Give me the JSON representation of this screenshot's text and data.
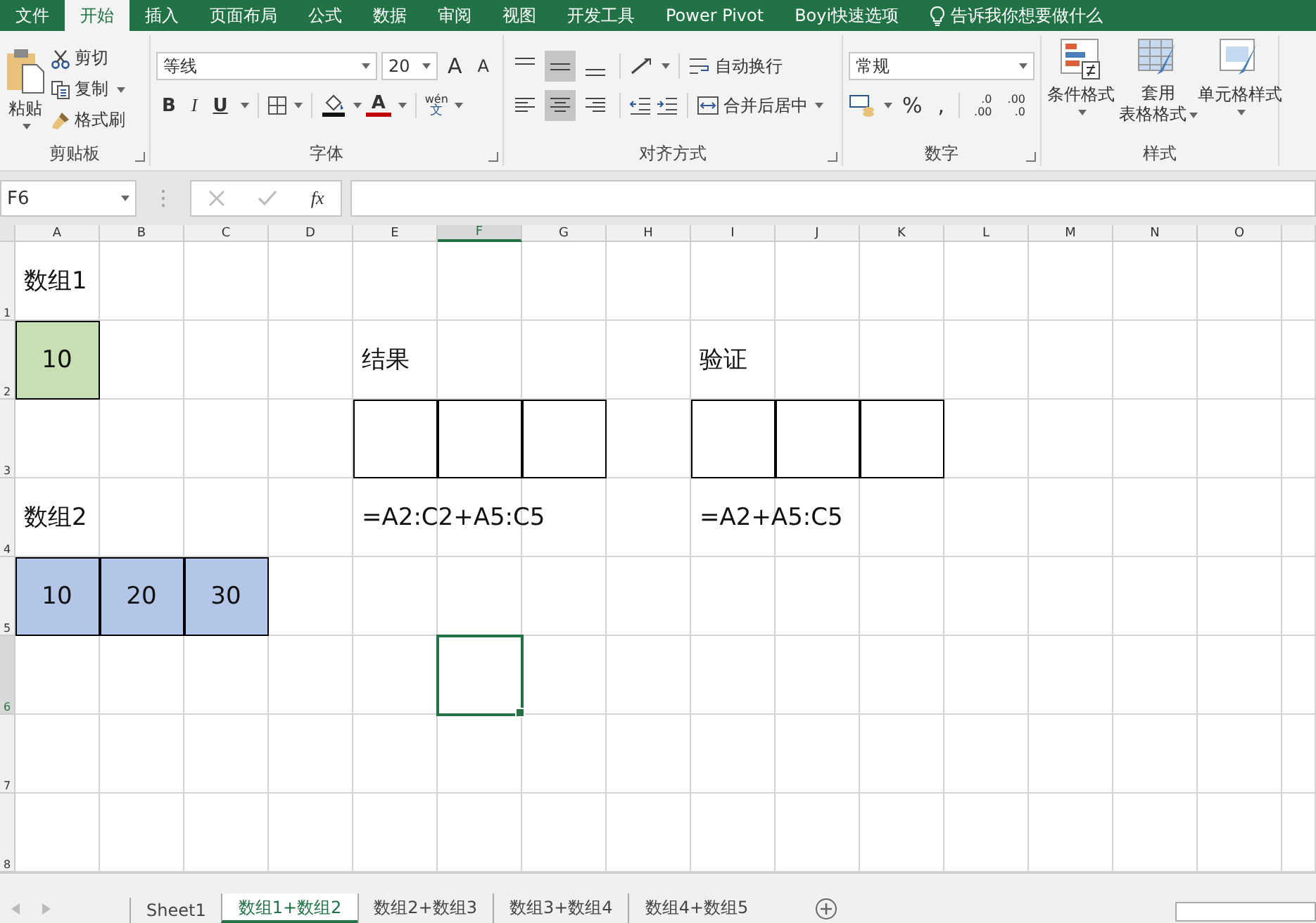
{
  "menu_tabs": [
    {
      "label": "文件",
      "selected": false
    },
    {
      "label": "开始",
      "selected": true
    },
    {
      "label": "插入",
      "selected": false
    },
    {
      "label": "页面布局",
      "selected": false
    },
    {
      "label": "公式",
      "selected": false
    },
    {
      "label": "数据",
      "selected": false
    },
    {
      "label": "审阅",
      "selected": false
    },
    {
      "label": "视图",
      "selected": false
    },
    {
      "label": "开发工具",
      "selected": false
    },
    {
      "label": "Power Pivot",
      "selected": false
    },
    {
      "label": "Boyi快速选项",
      "selected": false
    }
  ],
  "tell_me": "告诉我你想要做什么",
  "ribbon": {
    "clipboard": {
      "paste": "粘贴",
      "cut": "剪切",
      "copy": "复制",
      "format_painter": "格式刷",
      "label": "剪贴板"
    },
    "font": {
      "font_name": "等线",
      "font_size": "20",
      "grow": "A",
      "shrink": "A",
      "bold": "B",
      "italic": "I",
      "underline": "U",
      "font_color": "A",
      "phonetic_top": "wén",
      "phonetic_bottom": "文",
      "label": "字体"
    },
    "alignment": {
      "vertical": [
        {
          "selected": false
        },
        {
          "selected": true
        },
        {
          "selected": false
        }
      ],
      "horizontal": [
        {
          "selected": false
        },
        {
          "selected": true
        },
        {
          "selected": false
        }
      ],
      "wrap_text": "自动换行",
      "merge_center": "合并后居中",
      "label": "对齐方式"
    },
    "number": {
      "format": "常规",
      "percent": "%",
      "comma": ",",
      "increase_decimal": [
        ".0",
        ".00"
      ],
      "decrease_decimal": [
        ".00",
        ".0"
      ],
      "label": "数字"
    },
    "styles": {
      "conditional": "条件格式",
      "format_table": [
        "套用",
        "表格格式"
      ],
      "cell_styles": "单元格样式",
      "label": "样式"
    }
  },
  "formula_bar": {
    "name_box": "F6",
    "fx": "fx"
  },
  "sheet": {
    "columns": [
      {
        "label": "A",
        "selected": false
      },
      {
        "label": "B",
        "selected": false
      },
      {
        "label": "C",
        "selected": false
      },
      {
        "label": "D",
        "selected": false
      },
      {
        "label": "E",
        "selected": false
      },
      {
        "label": "F",
        "selected": true
      },
      {
        "label": "G",
        "selected": false
      },
      {
        "label": "H",
        "selected": false
      },
      {
        "label": "I",
        "selected": false
      },
      {
        "label": "J",
        "selected": false
      },
      {
        "label": "K",
        "selected": false
      },
      {
        "label": "L",
        "selected": false
      },
      {
        "label": "M",
        "selected": false
      },
      {
        "label": "N",
        "selected": false
      },
      {
        "label": "O",
        "selected": false
      }
    ],
    "rows": [
      {
        "label": "1",
        "selected": false,
        "cells": [
          {
            "text": "数组1",
            "kind": "text",
            "bordered": false,
            "selected": false
          },
          {
            "bordered": false,
            "selected": false
          },
          {
            "bordered": false,
            "selected": false
          },
          {
            "bordered": false,
            "selected": false
          },
          {
            "bordered": false,
            "selected": false
          },
          {
            "bordered": false,
            "selected": false
          },
          {
            "bordered": false,
            "selected": false
          },
          {
            "bordered": false,
            "selected": false
          },
          {
            "bordered": false,
            "selected": false
          },
          {
            "bordered": false,
            "selected": false
          },
          {
            "bordered": false,
            "selected": false
          },
          {
            "bordered": false,
            "selected": false
          },
          {
            "bordered": false,
            "selected": false
          },
          {
            "bordered": false,
            "selected": false
          },
          {
            "bordered": false,
            "selected": false
          }
        ]
      },
      {
        "label": "2",
        "selected": false,
        "cells": [
          {
            "text": "10",
            "kind": "number",
            "color": "#c6e0b4",
            "bordered": true,
            "selected": false
          },
          {
            "bordered": false,
            "selected": false
          },
          {
            "bordered": false,
            "selected": false
          },
          {
            "bordered": false,
            "selected": false
          },
          {
            "text": "结果",
            "kind": "text",
            "bordered": false,
            "selected": false
          },
          {
            "bordered": false,
            "selected": false
          },
          {
            "bordered": false,
            "selected": false
          },
          {
            "bordered": false,
            "selected": false
          },
          {
            "text": "验证",
            "kind": "text",
            "bordered": false,
            "selected": false
          },
          {
            "bordered": false,
            "selected": false
          },
          {
            "bordered": false,
            "selected": false
          },
          {
            "bordered": false,
            "selected": false
          },
          {
            "bordered": false,
            "selected": false
          },
          {
            "bordered": false,
            "selected": false
          },
          {
            "bordered": false,
            "selected": false
          }
        ]
      },
      {
        "label": "3",
        "selected": false,
        "cells": [
          {
            "bordered": false,
            "selected": false
          },
          {
            "bordered": false,
            "selected": false
          },
          {
            "bordered": false,
            "selected": false
          },
          {
            "bordered": false,
            "selected": false
          },
          {
            "bordered": true,
            "selected": false
          },
          {
            "bordered": true,
            "selected": false
          },
          {
            "bordered": true,
            "selected": false
          },
          {
            "bordered": false,
            "selected": false
          },
          {
            "bordered": true,
            "selected": false
          },
          {
            "bordered": true,
            "selected": false
          },
          {
            "bordered": true,
            "selected": false
          },
          {
            "bordered": false,
            "selected": false
          },
          {
            "bordered": false,
            "selected": false
          },
          {
            "bordered": false,
            "selected": false
          },
          {
            "bordered": false,
            "selected": false
          }
        ]
      },
      {
        "label": "4",
        "selected": false,
        "cells": [
          {
            "text": "数组2",
            "kind": "text",
            "bordered": false,
            "selected": false
          },
          {
            "bordered": false,
            "selected": false
          },
          {
            "bordered": false,
            "selected": false
          },
          {
            "bordered": false,
            "selected": false
          },
          {
            "text": "=A2:C2+A5:C5",
            "kind": "text",
            "bordered": false,
            "selected": false
          },
          {
            "bordered": false,
            "selected": false
          },
          {
            "bordered": false,
            "selected": false
          },
          {
            "bordered": false,
            "selected": false
          },
          {
            "text": "=A2+A5:C5",
            "kind": "text",
            "bordered": false,
            "selected": false
          },
          {
            "bordered": false,
            "selected": false
          },
          {
            "bordered": false,
            "selected": false
          },
          {
            "bordered": false,
            "selected": false
          },
          {
            "bordered": false,
            "selected": false
          },
          {
            "bordered": false,
            "selected": false
          },
          {
            "bordered": false,
            "selected": false
          }
        ]
      },
      {
        "label": "5",
        "selected": false,
        "cells": [
          {
            "text": "10",
            "kind": "number",
            "color": "#b4c6e7",
            "bordered": true,
            "selected": false
          },
          {
            "text": "20",
            "kind": "number",
            "color": "#b4c6e7",
            "bordered": true,
            "selected": false
          },
          {
            "text": "30",
            "kind": "number",
            "color": "#b4c6e7",
            "bordered": true,
            "selected": false
          },
          {
            "bordered": false,
            "selected": false
          },
          {
            "bordered": false,
            "selected": false
          },
          {
            "bordered": false,
            "selected": false
          },
          {
            "bordered": false,
            "selected": false
          },
          {
            "bordered": false,
            "selected": false
          },
          {
            "bordered": false,
            "selected": false
          },
          {
            "bordered": false,
            "selected": false
          },
          {
            "bordered": false,
            "selected": false
          },
          {
            "bordered": false,
            "selected": false
          },
          {
            "bordered": false,
            "selected": false
          },
          {
            "bordered": false,
            "selected": false
          },
          {
            "bordered": false,
            "selected": false
          }
        ]
      },
      {
        "label": "6",
        "selected": true,
        "cells": [
          {
            "bordered": false,
            "selected": false
          },
          {
            "bordered": false,
            "selected": false
          },
          {
            "bordered": false,
            "selected": false
          },
          {
            "bordered": false,
            "selected": false
          },
          {
            "bordered": false,
            "selected": false
          },
          {
            "bordered": false,
            "selected": true
          },
          {
            "bordered": false,
            "selected": false
          },
          {
            "bordered": false,
            "selected": false
          },
          {
            "bordered": false,
            "selected": false
          },
          {
            "bordered": false,
            "selected": false
          },
          {
            "bordered": false,
            "selected": false
          },
          {
            "bordered": false,
            "selected": false
          },
          {
            "bordered": false,
            "selected": false
          },
          {
            "bordered": false,
            "selected": false
          },
          {
            "bordered": false,
            "selected": false
          }
        ]
      },
      {
        "label": "7",
        "selected": false,
        "cells": [
          {
            "bordered": false,
            "selected": false
          },
          {
            "bordered": false,
            "selected": false
          },
          {
            "bordered": false,
            "selected": false
          },
          {
            "bordered": false,
            "selected": false
          },
          {
            "bordered": false,
            "selected": false
          },
          {
            "bordered": false,
            "selected": false
          },
          {
            "bordered": false,
            "selected": false
          },
          {
            "bordered": false,
            "selected": false
          },
          {
            "bordered": false,
            "selected": false
          },
          {
            "bordered": false,
            "selected": false
          },
          {
            "bordered": false,
            "selected": false
          },
          {
            "bordered": false,
            "selected": false
          },
          {
            "bordered": false,
            "selected": false
          },
          {
            "bordered": false,
            "selected": false
          },
          {
            "bordered": false,
            "selected": false
          }
        ]
      },
      {
        "label": "8",
        "selected": false,
        "cells": [
          {
            "bordered": false,
            "selected": false
          },
          {
            "bordered": false,
            "selected": false
          },
          {
            "bordered": false,
            "selected": false
          },
          {
            "bordered": false,
            "selected": false
          },
          {
            "bordered": false,
            "selected": false
          },
          {
            "bordered": false,
            "selected": false
          },
          {
            "bordered": false,
            "selected": false
          },
          {
            "bordered": false,
            "selected": false
          },
          {
            "bordered": false,
            "selected": false
          },
          {
            "bordered": false,
            "selected": false
          },
          {
            "bordered": false,
            "selected": false
          },
          {
            "bordered": false,
            "selected": false
          },
          {
            "bordered": false,
            "selected": false
          },
          {
            "bordered": false,
            "selected": false
          },
          {
            "bordered": false,
            "selected": false
          }
        ]
      }
    ]
  },
  "sheet_tabs": [
    {
      "label": "Sheet1",
      "selected": false
    },
    {
      "label": "数组1+数组2",
      "selected": true
    },
    {
      "label": "数组2+数组3",
      "selected": false
    },
    {
      "label": "数组3+数组4",
      "selected": false
    },
    {
      "label": "数组4+数组5",
      "selected": false
    }
  ]
}
